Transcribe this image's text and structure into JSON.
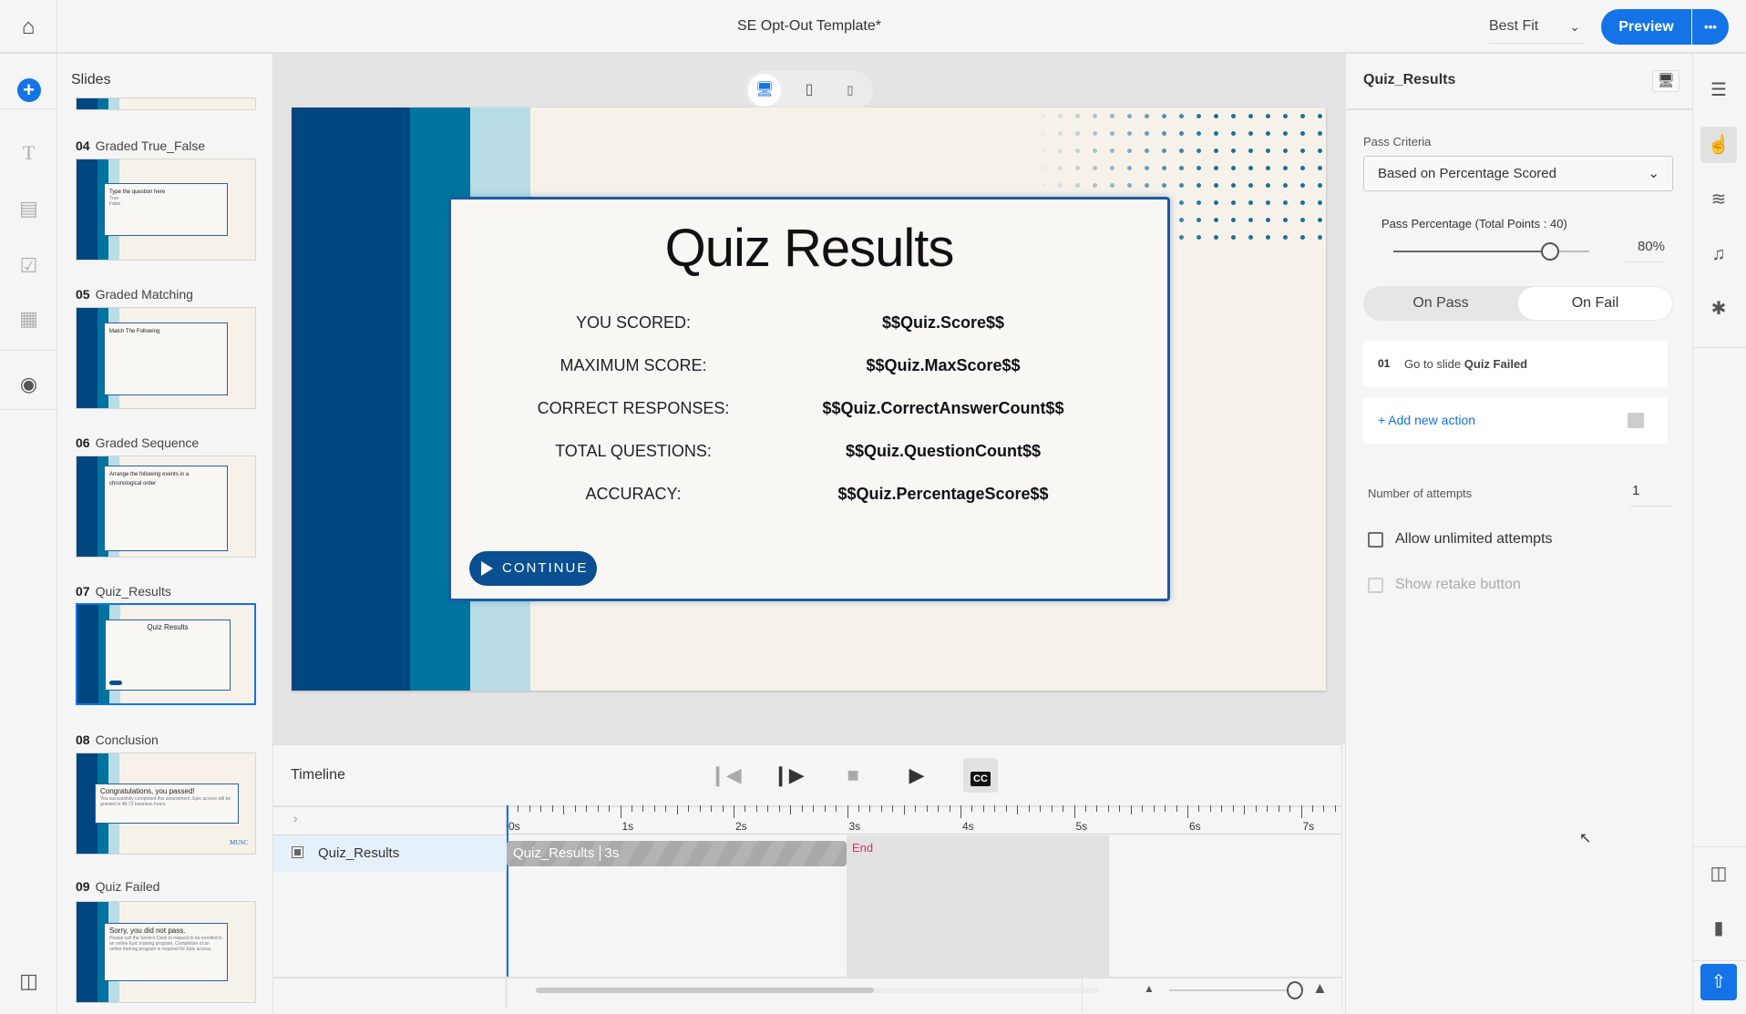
{
  "header": {
    "document_title": "SE Opt-Out Template*",
    "zoom_select": "Best Fit",
    "preview_label": "Preview",
    "more_label": "•••"
  },
  "left_rail": {
    "icons": [
      "home-icon",
      "add-icon",
      "text-icon",
      "media-icon",
      "quiz-icon",
      "widgets-icon",
      "record-icon",
      "panel-toggle-icon"
    ]
  },
  "slides_panel": {
    "title": "Slides",
    "items": [
      {
        "number": "04",
        "name": "Graded True_False",
        "preview_text": "Type the question here",
        "preview_options": [
          "True",
          "False"
        ]
      },
      {
        "number": "05",
        "name": "Graded Matching",
        "preview_text": "Match The Following"
      },
      {
        "number": "06",
        "name": "Graded Sequence",
        "preview_text": "Arrange the following events in a chronological order"
      },
      {
        "number": "07",
        "name": "Quiz_Results",
        "preview_text": "Quiz Results",
        "selected": true
      },
      {
        "number": "08",
        "name": "Conclusion",
        "preview_text": "Congratulations, you passed!",
        "preview_body": "You successfully completed this assessment. Epic access will be granted in 48-72 business hours.",
        "preview_logo": "MUSC"
      },
      {
        "number": "09",
        "name": "Quiz Failed",
        "preview_text": "Sorry, you did not pass.",
        "preview_body": "Please call the Service Desk to request to be enrolled in an online Epic training program. Completion of an online training program is required for Epic access."
      }
    ]
  },
  "device_toggle": {
    "options": [
      "desktop",
      "tablet",
      "mobile"
    ],
    "selected": "desktop"
  },
  "slide": {
    "title": "Quiz Results",
    "rows": [
      {
        "label": "YOU SCORED:",
        "value": "$$Quiz.Score$$"
      },
      {
        "label": "MAXIMUM SCORE:",
        "value": "$$Quiz.MaxScore$$"
      },
      {
        "label": "CORRECT RESPONSES:",
        "value": "$$Quiz.CorrectAnswerCount$$"
      },
      {
        "label": "TOTAL QUESTIONS:",
        "value": "$$Quiz.QuestionCount$$"
      },
      {
        "label": "ACCURACY:",
        "value": "$$Quiz.PercentageScore$$"
      }
    ],
    "continue_label": "CONTINUE",
    "colors": {
      "dark_blue": "#00467f",
      "teal": "#00749e",
      "light_blue": "#b8dde6",
      "background": "#f6f2ea",
      "button": "#0a4f91"
    }
  },
  "timeline": {
    "title": "Timeline",
    "controls": [
      "rewind",
      "play-from-playhead",
      "stop",
      "play",
      "closed-captions"
    ],
    "cc_label": "CC",
    "ticks": [
      "0s",
      "1s",
      "2s",
      "3s",
      "4s",
      "5s",
      "6s",
      "7s"
    ],
    "track_name": "Quiz_Results",
    "clip_label": "Quiz_Results",
    "clip_duration": "3s",
    "end_label": "End"
  },
  "properties": {
    "title": "Quiz_Results",
    "pass_criteria_label": "Pass Criteria",
    "pass_criteria_value": "Based on Percentage Scored",
    "pass_percentage_label": "Pass Percentage (Total Points : 40)",
    "pass_percentage_value": "80%",
    "pass_percentage": 80,
    "tabs": [
      "On Pass",
      "On Fail"
    ],
    "active_tab": "On Fail",
    "action": {
      "index": "01",
      "text": "Go to slide",
      "target": "Quiz Failed"
    },
    "add_action_label": "+ Add new action",
    "attempts_label": "Number of attempts",
    "attempts_value": "1",
    "allow_unlimited_label": "Allow unlimited attempts",
    "allow_unlimited_checked": false,
    "show_retake_label": "Show retake button",
    "show_retake_checked": false
  },
  "right_rail": {
    "icons": [
      "properties-icon",
      "interactions-icon",
      "animations-icon",
      "audio-icon",
      "accessibility-icon",
      "slide-panel-icon",
      "notes-icon",
      "publish-icon"
    ]
  },
  "accent_color": "#1473e6"
}
